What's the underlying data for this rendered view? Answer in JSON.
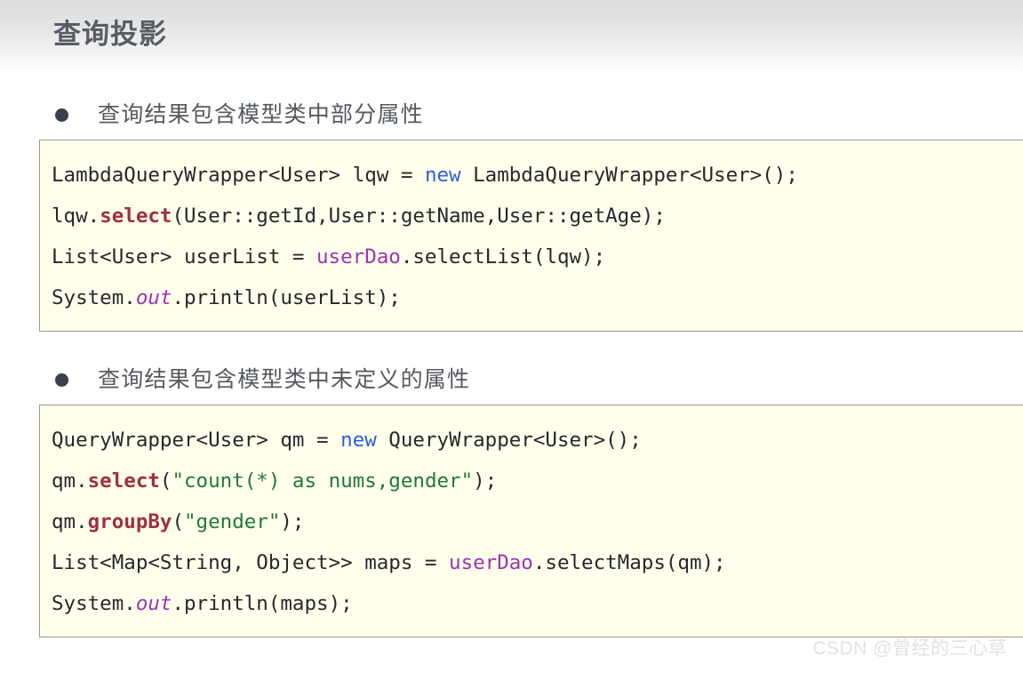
{
  "header": {
    "title": "查询投影"
  },
  "sections": [
    {
      "bullet": "查询结果包含模型类中部分属性",
      "code_lines": [
        [
          {
            "t": "LambdaQueryWrapper<User> lqw = ",
            "c": "tok-plain"
          },
          {
            "t": "new",
            "c": "tok-kw"
          },
          {
            "t": " LambdaQueryWrapper<User>();",
            "c": "tok-plain"
          }
        ],
        [
          {
            "t": "lqw.",
            "c": "tok-plain"
          },
          {
            "t": "select",
            "c": "tok-method"
          },
          {
            "t": "(User::getId,User::getName,User::getAge);",
            "c": "tok-plain"
          }
        ],
        [
          {
            "t": "List<User> userList = ",
            "c": "tok-plain"
          },
          {
            "t": "userDao",
            "c": "tok-field"
          },
          {
            "t": ".selectList(lqw);",
            "c": "tok-plain"
          }
        ],
        [
          {
            "t": "System.",
            "c": "tok-plain"
          },
          {
            "t": "out",
            "c": "tok-field-i"
          },
          {
            "t": ".println(userList);",
            "c": "tok-plain"
          }
        ]
      ]
    },
    {
      "bullet": "查询结果包含模型类中未定义的属性",
      "code_lines": [
        [
          {
            "t": "QueryWrapper<User> qm = ",
            "c": "tok-plain"
          },
          {
            "t": "new",
            "c": "tok-kw"
          },
          {
            "t": " QueryWrapper<User>();",
            "c": "tok-plain"
          }
        ],
        [
          {
            "t": "qm.",
            "c": "tok-plain"
          },
          {
            "t": "select",
            "c": "tok-method"
          },
          {
            "t": "(",
            "c": "tok-plain"
          },
          {
            "t": "\"count(*) as nums,gender\"",
            "c": "tok-str"
          },
          {
            "t": ");",
            "c": "tok-plain"
          }
        ],
        [
          {
            "t": "qm.",
            "c": "tok-plain"
          },
          {
            "t": "groupBy",
            "c": "tok-method"
          },
          {
            "t": "(",
            "c": "tok-plain"
          },
          {
            "t": "\"gender\"",
            "c": "tok-str"
          },
          {
            "t": ");",
            "c": "tok-plain"
          }
        ],
        [
          {
            "t": "List<Map<String, Object>> maps = ",
            "c": "tok-plain"
          },
          {
            "t": "userDao",
            "c": "tok-field"
          },
          {
            "t": ".selectMaps(qm);",
            "c": "tok-plain"
          }
        ],
        [
          {
            "t": "System.",
            "c": "tok-plain"
          },
          {
            "t": "out",
            "c": "tok-field-i"
          },
          {
            "t": ".println(maps);",
            "c": "tok-plain"
          }
        ]
      ]
    }
  ],
  "watermark": {
    "text": "CSDN @曾经的三心草"
  },
  "colors": {
    "header_gradient_start": "#dedede",
    "header_gradient_end": "#ffffff",
    "title_text": "#595d63",
    "bullet_text": "#56595e",
    "code_background": "#ffffec",
    "code_border": "#9b9b8c",
    "code_text": "#24292e",
    "keyword": "#2b5fdd",
    "method": "#9f3040",
    "field": "#9b34b5",
    "string": "#1f7a34",
    "watermark": "#e2e2e2"
  }
}
